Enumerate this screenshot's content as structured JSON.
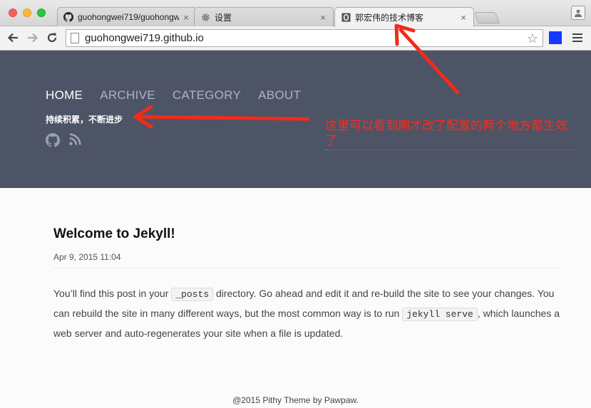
{
  "browser": {
    "tabs": [
      {
        "label": "guohongwei719/guohongw",
        "icon": "github-icon"
      },
      {
        "label": "设置",
        "icon": "gear-icon"
      },
      {
        "label": "郭宏伟的技术博客",
        "icon": "page-icon"
      }
    ],
    "close_glyph": "×",
    "url": "guohongwei719.github.io",
    "star_glyph": "☆",
    "accent_extension_color": "#1638ff"
  },
  "site": {
    "nav": [
      "HOME",
      "ARCHIVE",
      "CATEGORY",
      "ABOUT"
    ],
    "tagline": "持续积累，不断进步",
    "social_icons": [
      "github-icon",
      "rss-icon"
    ],
    "header_color": "#4d5466"
  },
  "annotation": {
    "text": "这里可以看到刚才改了配置的两个地方都生效了",
    "color": "#ff2a1a"
  },
  "post": {
    "title": "Welcome to Jekyll!",
    "date": "Apr 9, 2015 11:04",
    "p1_a": "You’ll find this post in your ",
    "p1_code": "_posts",
    "p1_b": " directory. Go ahead and edit it and re-build the site to see your changes. You can rebuild the site in many different ways, but the most common way is to run ",
    "p1_code2": "jekyll serve",
    "p1_c": ", which launches a web server and auto-regenerates your site when a file is updated."
  },
  "footer": "@2015 Pithy Theme by Pawpaw."
}
